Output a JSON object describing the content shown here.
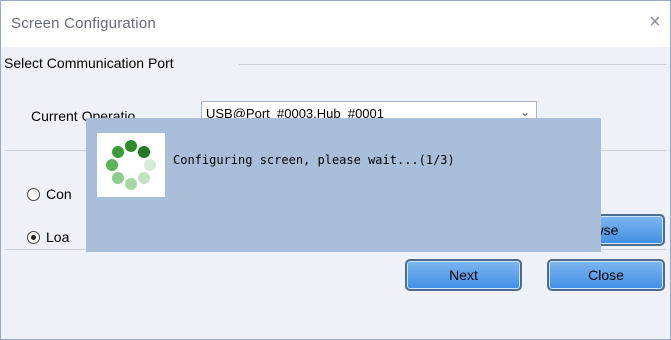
{
  "dialog": {
    "title": "Screen Configuration",
    "close_glyph": "×"
  },
  "port_group": {
    "legend": "Select Communication Port",
    "current_label": "Current Operatio",
    "port_value": "USB@Port_#0003.Hub_#0001",
    "dropdown_glyph": "⌄"
  },
  "options": [
    {
      "label": "Con",
      "checked": false
    },
    {
      "label": "Loa",
      "checked": true
    }
  ],
  "buttons": {
    "browse": "wse",
    "next": "Next",
    "close": "Close"
  },
  "progress": {
    "message": "Configuring screen, please wait...(1/3)",
    "spinner_icon": "loading-spinner-icon",
    "colors": {
      "dark": "#2e8b2e",
      "mid": "#5bb25b",
      "light": "#a5d8a5",
      "overlay": "#a9bfd9",
      "button": "#4f9ae8"
    }
  }
}
